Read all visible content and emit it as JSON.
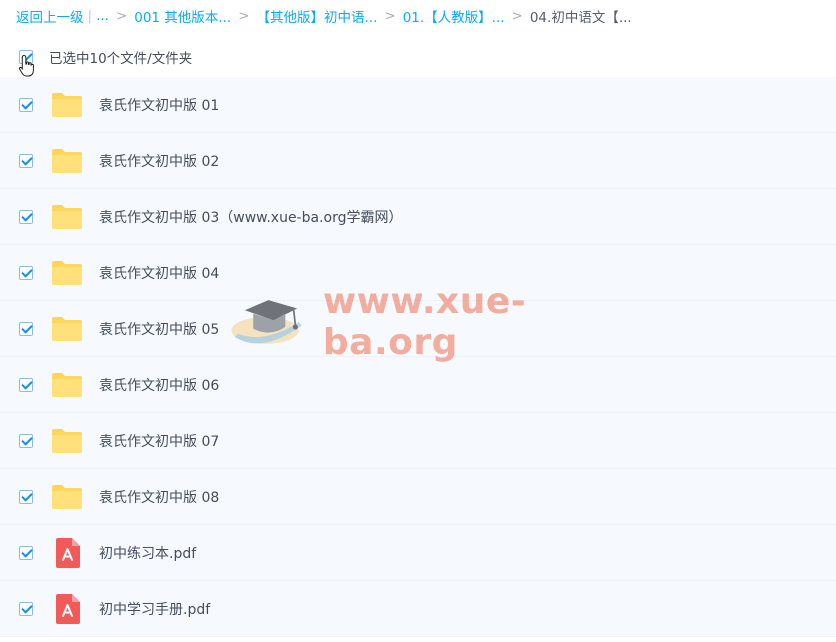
{
  "breadcrumb": {
    "back_label": "返回上一级",
    "pipe": "|",
    "ellipsis": "...",
    "items": [
      "001 其他版本...",
      "【其他版】初中语...",
      "01.【人教版】...",
      "04.初中语文【..."
    ]
  },
  "selection": {
    "text": "已选中10个文件/文件夹"
  },
  "files": [
    {
      "name": "袁氏作文初中版 01",
      "type": "folder",
      "checked": true
    },
    {
      "name": "袁氏作文初中版 02",
      "type": "folder",
      "checked": true
    },
    {
      "name": "袁氏作文初中版 03（www.xue-ba.org学霸网）",
      "type": "folder",
      "checked": true
    },
    {
      "name": "袁氏作文初中版 04",
      "type": "folder",
      "checked": true
    },
    {
      "name": "袁氏作文初中版 05",
      "type": "folder",
      "checked": true
    },
    {
      "name": "袁氏作文初中版 06",
      "type": "folder",
      "checked": true
    },
    {
      "name": "袁氏作文初中版 07",
      "type": "folder",
      "checked": true
    },
    {
      "name": "袁氏作文初中版 08",
      "type": "folder",
      "checked": true
    },
    {
      "name": "初中练习本.pdf",
      "type": "pdf",
      "checked": true
    },
    {
      "name": "初中学习手册.pdf",
      "type": "pdf",
      "checked": true
    }
  ],
  "watermark": {
    "text": "www.xue-ba.org"
  },
  "colors": {
    "link": "#09aaff",
    "folder": "#ffd659",
    "pdf": "#f25a5a",
    "row_bg": "#f6faff"
  }
}
